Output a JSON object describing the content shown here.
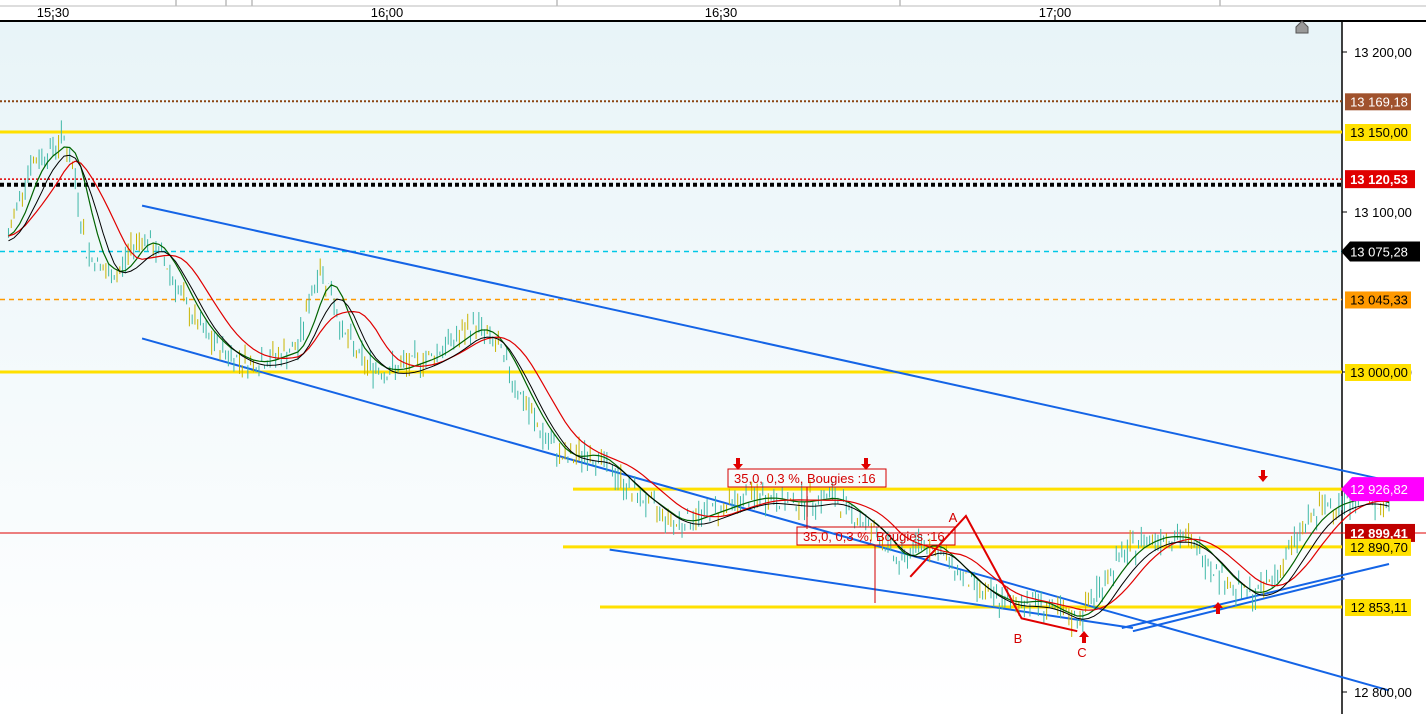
{
  "chart_data": {
    "type": "line",
    "instrument_series": "price",
    "x_ticks": [
      "15:30",
      "16:00",
      "16:30",
      "17:00"
    ],
    "y_ticks": [
      "13 200,00",
      "13 100,00",
      "13 000,00",
      "12 800,00"
    ],
    "ylim": [
      12780,
      13235
    ],
    "xlim": [
      "15:26",
      "17:38"
    ],
    "grid": false,
    "price_points": [
      [
        "15:26",
        13085
      ],
      [
        "15:27",
        13110
      ],
      [
        "15:28",
        13130
      ],
      [
        "15:30",
        13140
      ],
      [
        "15:31",
        13147
      ],
      [
        "15:32",
        13120
      ],
      [
        "15:33",
        13075
      ],
      [
        "15:35",
        13060
      ],
      [
        "15:36",
        13062
      ],
      [
        "15:37",
        13078
      ],
      [
        "15:38",
        13085
      ],
      [
        "15:40",
        13070
      ],
      [
        "15:42",
        13040
      ],
      [
        "15:44",
        13020
      ],
      [
        "15:46",
        13010
      ],
      [
        "15:48",
        13005
      ],
      [
        "15:50",
        13010
      ],
      [
        "15:52",
        13015
      ],
      [
        "15:53",
        13045
      ],
      [
        "15:54",
        13065
      ],
      [
        "15:55",
        13050
      ],
      [
        "15:56",
        13025
      ],
      [
        "15:58",
        13005
      ],
      [
        "16:00",
        13000
      ],
      [
        "16:02",
        13005
      ],
      [
        "16:04",
        13010
      ],
      [
        "16:06",
        13020
      ],
      [
        "16:08",
        13030
      ],
      [
        "16:10",
        13015
      ],
      [
        "16:12",
        12985
      ],
      [
        "16:14",
        12960
      ],
      [
        "16:16",
        12945
      ],
      [
        "16:18",
        12950
      ],
      [
        "16:20",
        12940
      ],
      [
        "16:22",
        12925
      ],
      [
        "16:24",
        12915
      ],
      [
        "16:26",
        12905
      ],
      [
        "16:28",
        12910
      ],
      [
        "16:30",
        12915
      ],
      [
        "16:32",
        12920
      ],
      [
        "16:34",
        12922
      ],
      [
        "16:36",
        12918
      ],
      [
        "16:38",
        12920
      ],
      [
        "16:40",
        12922
      ],
      [
        "16:42",
        12910
      ],
      [
        "16:44",
        12900
      ],
      [
        "16:46",
        12880
      ],
      [
        "16:48",
        12895
      ],
      [
        "16:50",
        12885
      ],
      [
        "16:52",
        12870
      ],
      [
        "16:54",
        12860
      ],
      [
        "16:56",
        12855
      ],
      [
        "16:58",
        12858
      ],
      [
        "17:00",
        12850
      ],
      [
        "17:02",
        12845
      ],
      [
        "17:04",
        12865
      ],
      [
        "17:06",
        12885
      ],
      [
        "17:08",
        12895
      ],
      [
        "17:10",
        12898
      ],
      [
        "17:12",
        12895
      ],
      [
        "17:14",
        12880
      ],
      [
        "17:16",
        12865
      ],
      [
        "17:18",
        12860
      ],
      [
        "17:20",
        12875
      ],
      [
        "17:22",
        12900
      ],
      [
        "17:24",
        12915
      ],
      [
        "17:26",
        12920
      ],
      [
        "17:28",
        12922
      ],
      [
        "17:29",
        12918
      ],
      [
        "17:30",
        12915
      ]
    ],
    "horizontal_levels": [
      {
        "label": "13 169,18",
        "value": 13169.18,
        "color": "#8b4513",
        "style": "dotted"
      },
      {
        "label": "13 150,00",
        "value": 13150,
        "color": "#ffe000",
        "style": "solid"
      },
      {
        "label": "13 120,53",
        "value": 13120.53,
        "color": "#e00000",
        "style": "dotted"
      },
      {
        "label": "13 075,28",
        "value": 13075.28,
        "color": "#00c8e6",
        "style": "dashed"
      },
      {
        "label": "13 045,33",
        "value": 13045.33,
        "color": "#ff9900",
        "style": "dashed"
      },
      {
        "label": "13 000,00",
        "value": 13000,
        "color": "#ffe000",
        "style": "solid"
      },
      {
        "label": "12 926,82",
        "value": 12926.82,
        "color": "#ffe000",
        "style": "solid"
      },
      {
        "label": "12 899,41",
        "value": 12899.41,
        "color": "#e00000",
        "style": "solid"
      },
      {
        "label": "12 890,70",
        "value": 12890.7,
        "color": "#ffe000",
        "style": "solid"
      },
      {
        "label": "12 853,11",
        "value": 12853.11,
        "color": "#ffe000",
        "style": "solid"
      }
    ],
    "badges": [
      {
        "label": "13 169,18",
        "value": 13169.18,
        "bg": "#a0522d",
        "fg": "#ffffff"
      },
      {
        "label": "13 150,00",
        "value": 13150,
        "bg": "#ffe000",
        "fg": "#000000"
      },
      {
        "label": "13 120,53",
        "value": 13120.53,
        "bg": "#e00000",
        "fg": "#ffffff"
      },
      {
        "label": "13 075,28",
        "value": 13075.28,
        "bg": "#000000",
        "fg": "#ffffff"
      },
      {
        "label": "13 045,33",
        "value": 13045.33,
        "bg": "#ff9900",
        "fg": "#000000"
      },
      {
        "label": "13 000,00",
        "value": 13000,
        "bg": "#ffe000",
        "fg": "#000000"
      },
      {
        "label": "12 926,82",
        "value": 12926.82,
        "bg": "#ff00ff",
        "fg": "#ffffff"
      },
      {
        "label": "12 899,41",
        "value": 12899.41,
        "bg": "#c00000",
        "fg": "#ffffff"
      },
      {
        "label": "12 890,70",
        "value": 12890.7,
        "bg": "#ffe000",
        "fg": "#000000"
      },
      {
        "label": "12 853,11",
        "value": 12853.11,
        "bg": "#ffe000",
        "fg": "#000000"
      }
    ],
    "annotations": [
      {
        "text": "35,0, 0,3 %, Bougies :16"
      },
      {
        "text": "35,0, 0,3 %, Bougies :16"
      },
      {
        "text": "A"
      },
      {
        "text": "B"
      },
      {
        "text": "C"
      }
    ],
    "colors": {
      "price": "#2e8b57",
      "ma_fast": "#006400",
      "ma_slow": "#e00000",
      "ma_black": "#000000",
      "trendline": "#1464e6",
      "background_top": "#e8f4f8"
    }
  }
}
